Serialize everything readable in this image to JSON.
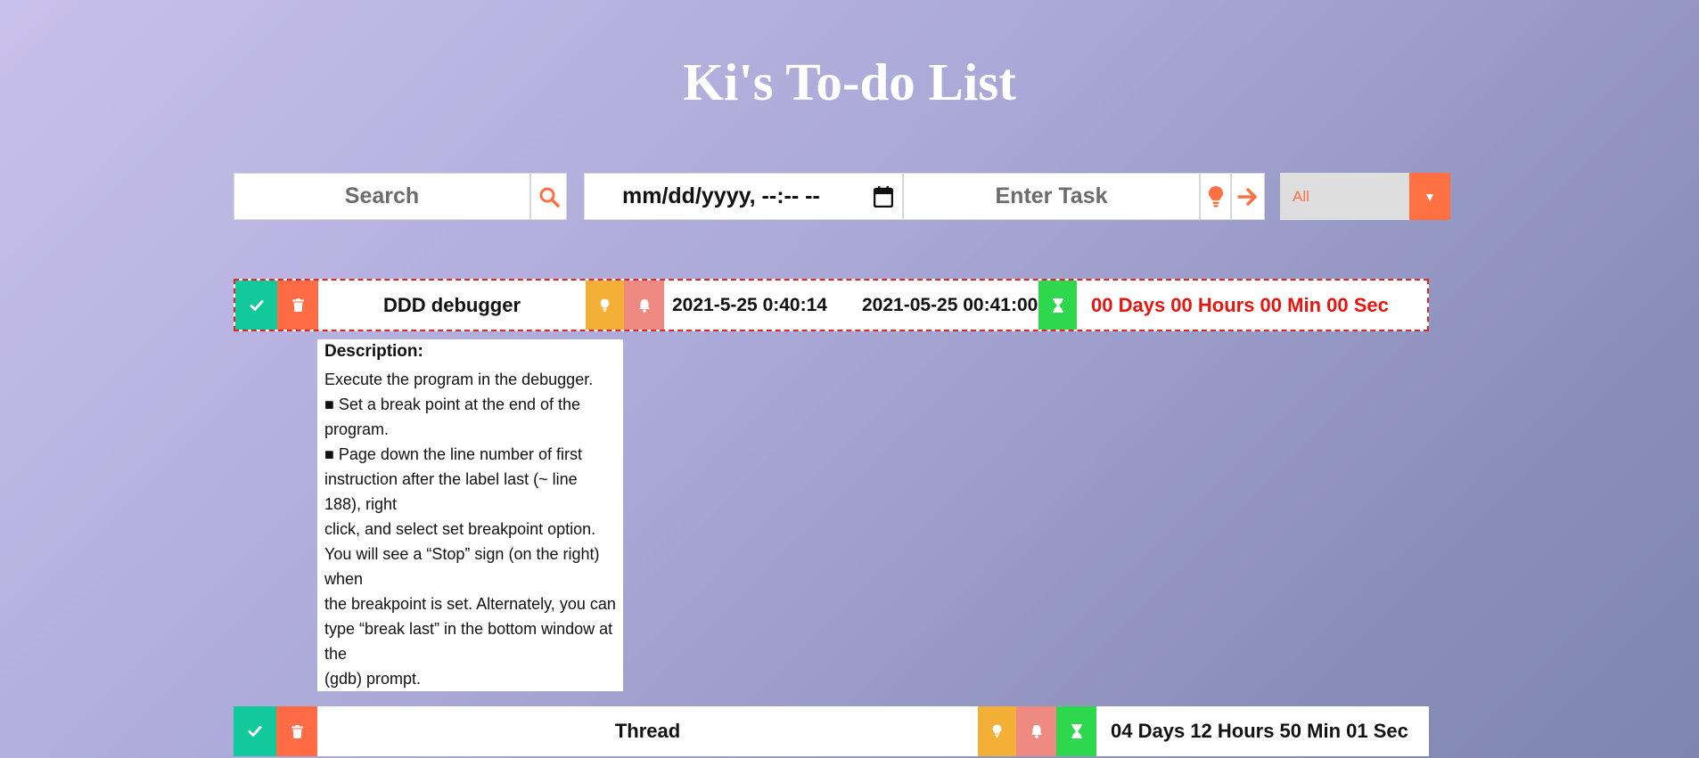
{
  "page": {
    "title": "Ki's To-do List"
  },
  "toolbar": {
    "search_placeholder": "Search",
    "date_placeholder": "mm/dd/yyyy, --:-- --",
    "task_placeholder": "Enter Task",
    "filter_value": "All",
    "filter_arrow": "▼"
  },
  "colors": {
    "done": "#12c99b",
    "delete": "#ff6b45",
    "idea": "#f4b036",
    "bell": "#ef8a82",
    "timer": "#2ed84c",
    "accent": "#ff7043",
    "overdue": "#e8150f"
  },
  "tasks": [
    {
      "name": "DDD debugger",
      "created": "2021-5-25 0:40:14",
      "due": "2021-05-25 00:41:00",
      "countdown": "00 Days 00 Hours 00 Min 00 Sec",
      "overdue": true,
      "description_label": "Description:",
      "description_lines": [
        "Execute the program in the debugger.",
        "■ Set a break point at the end of the program.",
        "■ Page down the line number of first instruction after the label last (~ line 188), right",
        "click, and select set breakpoint option.",
        "You will see a “Stop” sign (on the right) when",
        "the breakpoint is set. Alternately, you can type “break last” in the bottom window at the",
        "(gdb) prompt."
      ]
    },
    {
      "name": "Thread",
      "countdown": "04 Days 12 Hours 50 Min 01 Sec",
      "overdue": false
    }
  ]
}
